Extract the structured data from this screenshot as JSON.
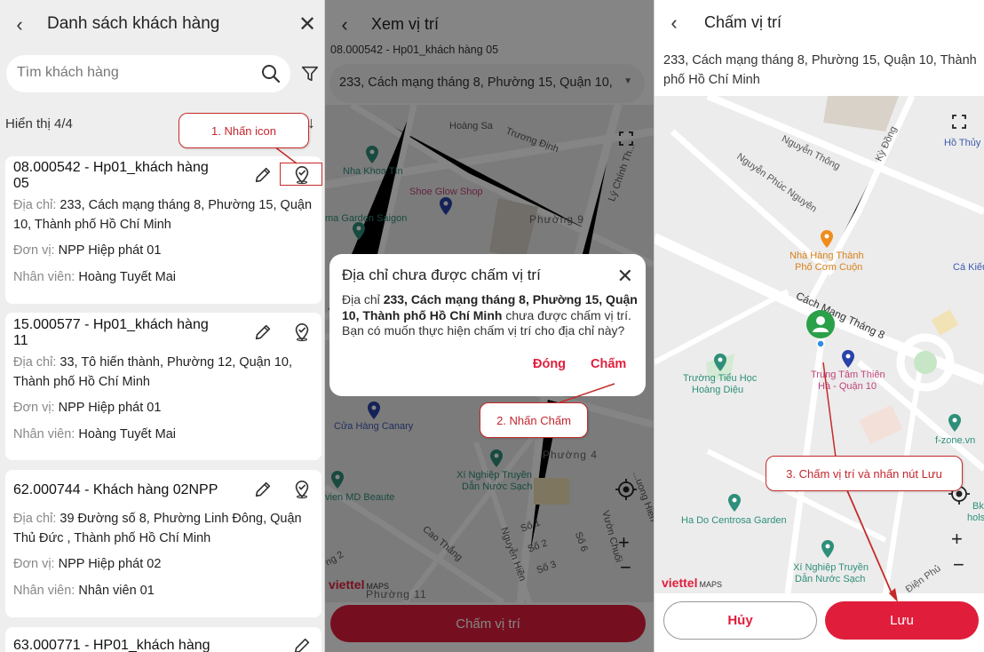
{
  "panel1": {
    "title": "Danh sách khách hàng",
    "search_placeholder": "Tìm khách hàng",
    "count_label": "Hiển thị 4/4",
    "callout": "1. Nhấn icon",
    "labels": {
      "address": "Địa chỉ:",
      "unit": "Đơn vị:",
      "staff": "Nhân viên:"
    },
    "customers": [
      {
        "title": "08.000542 - Hp01_khách hàng 05",
        "address": "233, Cách mạng tháng 8, Phường 15, Quận 10, Thành phố Hồ Chí Minh",
        "unit": "NPP Hiệp phát 01",
        "staff": "Hoàng Tuyết Mai"
      },
      {
        "title": "15.000577 - Hp01_khách hàng 11",
        "address": "33, Tô hiến thành, Phường 12, Quận 10, Thành phố Hồ Chí Minh",
        "unit": "NPP Hiệp phát 01",
        "staff": "Hoàng Tuyết Mai"
      },
      {
        "title": "62.000744 - Khách hàng 02NPP",
        "address": "39 Đường số 8, Phường Linh Đông, Quận Thủ Đức , Thành phố Hồ Chí Minh",
        "unit": "NPP Hiệp phát 02",
        "staff": "Nhân viên 01"
      },
      {
        "title": "63.000771 - HP01_khách hàng"
      }
    ]
  },
  "panel2": {
    "title": "Xem vị trí",
    "subtitle": "08.000542 - Hp01_khách hàng 05",
    "address_select": "233, Cách mạng tháng 8, Phường 15, Quận 10, ...",
    "button": "Chấm vị trí",
    "callout": "2. Nhấn Chấm",
    "map": {
      "brand": "viettel",
      "brand_suffix": "MAPS",
      "labels": {
        "hoang_sa": "Hoàng Sa",
        "truong_dinh": "Trương Định",
        "ly_chinh_thang": "Lý Chính Th...",
        "nha_khoa_tin": "Nha Khoa Tín",
        "shoe_glow": "Shoe Glow Shop",
        "garden_saigon": "ma Garden Saigon",
        "phuong9": "Phường 9",
        "cua_hang_canary": "Cửa Hàng Canary",
        "phuong4": "Phường 4",
        "xi_nghiep_1": "Xí Nghiệp Truyền",
        "xi_nghiep_2": "Dẫn Nước Sạch",
        "md_beaute": "vien MD Beaute",
        "cao_thang": "Cao Thắng",
        "nguyen_hien": "Nguyễn Hiền",
        "vuon_chuoi": "Vườn Chuối",
        "truong_hien": "...uong Hiển",
        "so1": "Số 1",
        "so2": "Số 2",
        "so3": "Số 3",
        "so6": "Số 6",
        "phuong11": "Phường 11",
        "ng2": "ng 2"
      }
    },
    "dialog": {
      "title": "Địa chỉ chưa được chấm vị trí",
      "body_pre": "Địa chỉ ",
      "body_bold": "233, Cách mạng tháng 8, Phường 15, Quận 10, Thành phố Hồ Chí Minh",
      "body_post": " chưa được chấm vị trí. Bạn có muốn thực hiện chấm vị trí cho địa chỉ này?",
      "btn_close": "Đóng",
      "btn_confirm": "Chấm"
    }
  },
  "panel3": {
    "title": "Chấm vị trí",
    "address": "233, Cách mạng tháng 8, Phường 15, Quận 10, Thành phố Hồ Chí Minh",
    "btn_cancel": "Hủy",
    "btn_save": "Lưu",
    "callout": "3. Chấm vị trí và nhấn nút Lưu",
    "map": {
      "brand": "viettel",
      "brand_suffix": "MAPS",
      "labels": {
        "nguyen_thong": "Nguyễn Thông",
        "ky_dong": "Kỳ Đồng",
        "ho_thuy": "Hồ Thủy",
        "nguyen_phuc_nguyen": "Nguyễn Phúc Nguyên",
        "nha_hang_1": "Nhà Hàng Thành",
        "nha_hang_2": "Phố Cơm Cuộn",
        "ca_kieu": "Cá Kiếu",
        "cmt8": "Cách Mạng Tháng 8",
        "truong_th_1": "Trường Tiểu Học",
        "truong_th_2": "Hoàng Diệu",
        "trung_tam_1": "Trung Tâm Thiên",
        "trung_tam_2": "Hà - Quận 10",
        "fzone": "f-zone.vn",
        "hado": "Ha Do Centrosa Garden",
        "bk": "Bk",
        "hols": "hols",
        "xn_1": "Xí Nghiệp Truyền",
        "xn_2": "Dẫn Nước Sạch",
        "dien_phu": "Điện Phủ"
      }
    }
  }
}
